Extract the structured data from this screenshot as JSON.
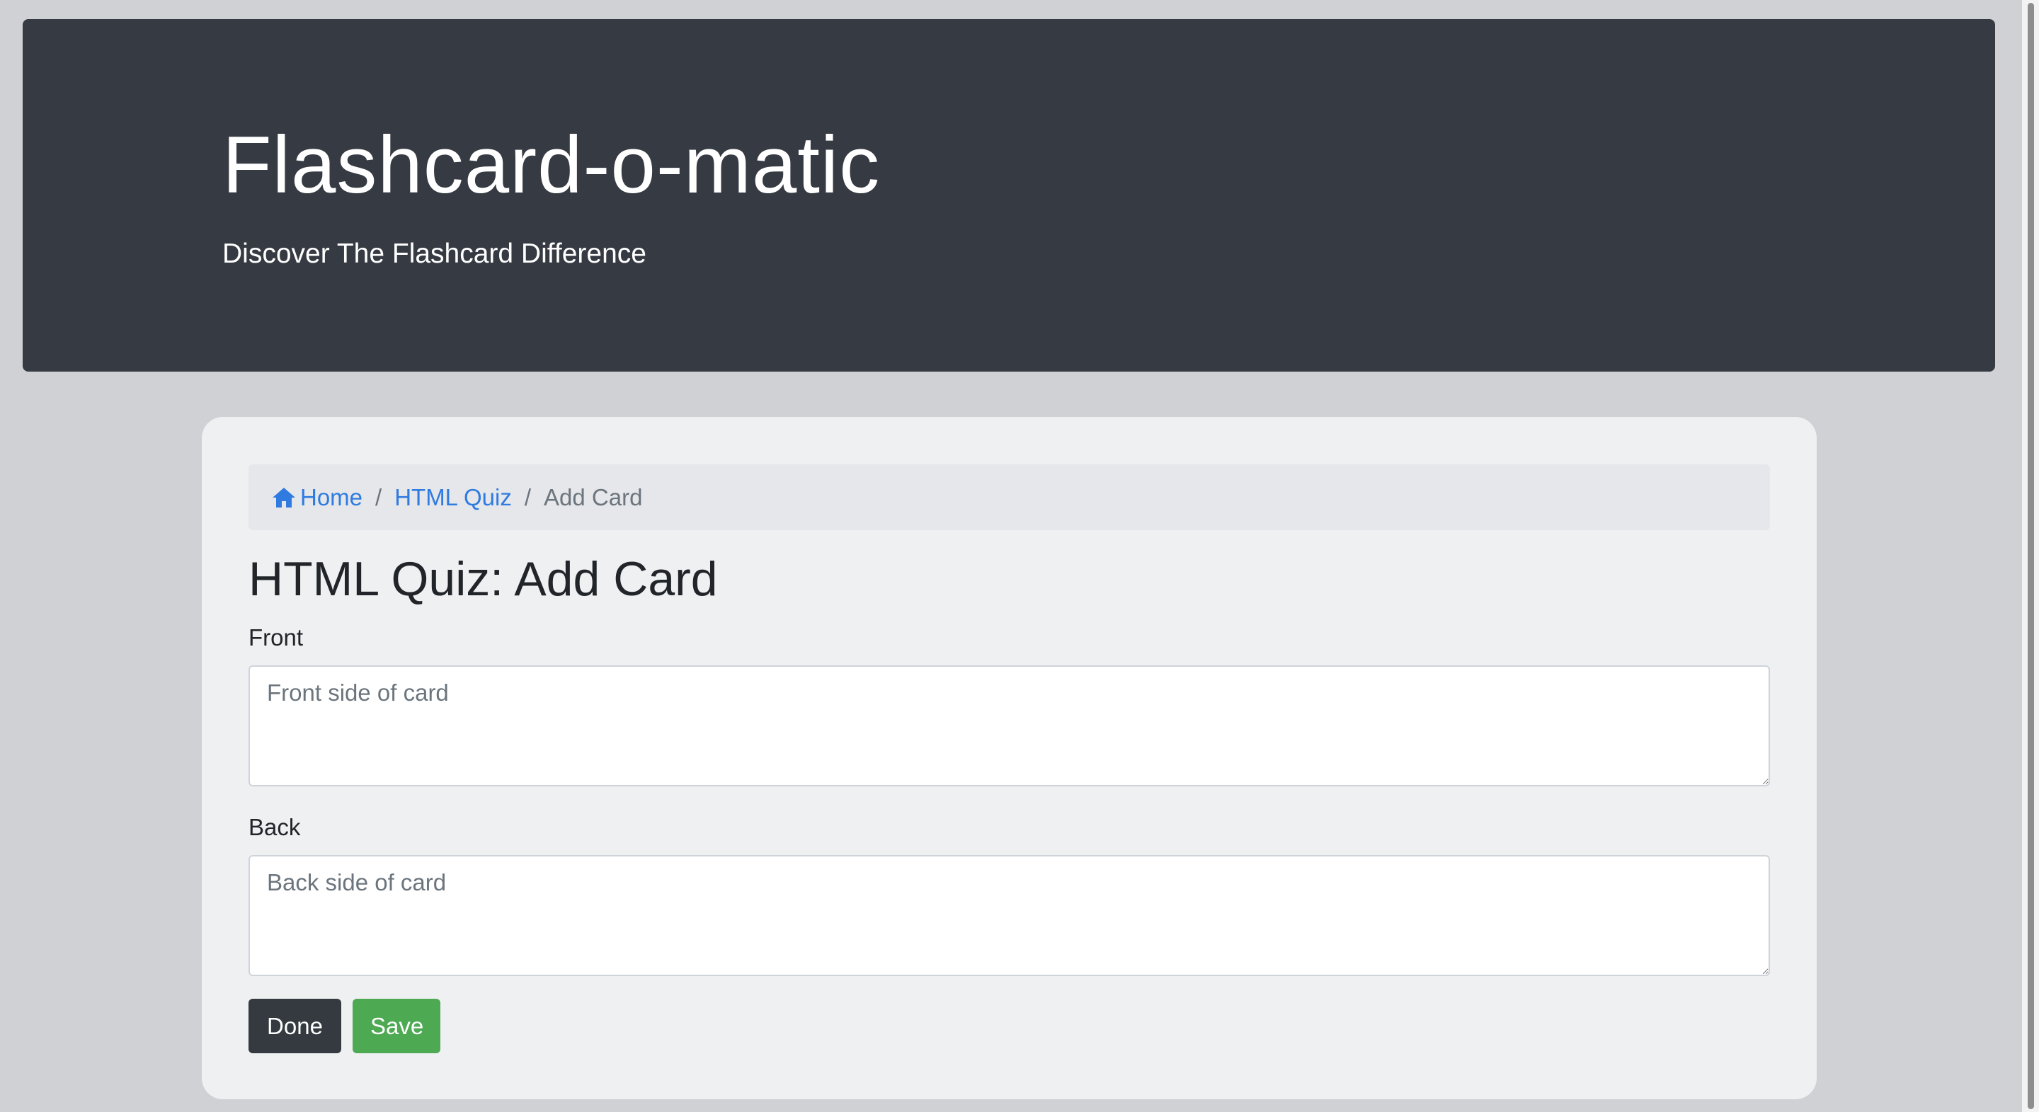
{
  "header": {
    "title": "Flashcard-o-matic",
    "subtitle": "Discover The Flashcard Difference"
  },
  "breadcrumb": {
    "home_icon": "home-icon",
    "home_label": "Home",
    "deck_label": "HTML Quiz",
    "current_label": "Add Card",
    "separator": "/"
  },
  "main": {
    "heading": "HTML Quiz: Add Card",
    "front": {
      "label": "Front",
      "value": "",
      "placeholder": "Front side of card"
    },
    "back": {
      "label": "Back",
      "value": "",
      "placeholder": "Back side of card"
    }
  },
  "buttons": {
    "done_label": "Done",
    "save_label": "Save"
  },
  "colors": {
    "page_background": "#d0d1d4",
    "header_background": "#363a42",
    "link": "#2f7be0",
    "done_button": "#343a40",
    "save_button": "#4ea953"
  }
}
